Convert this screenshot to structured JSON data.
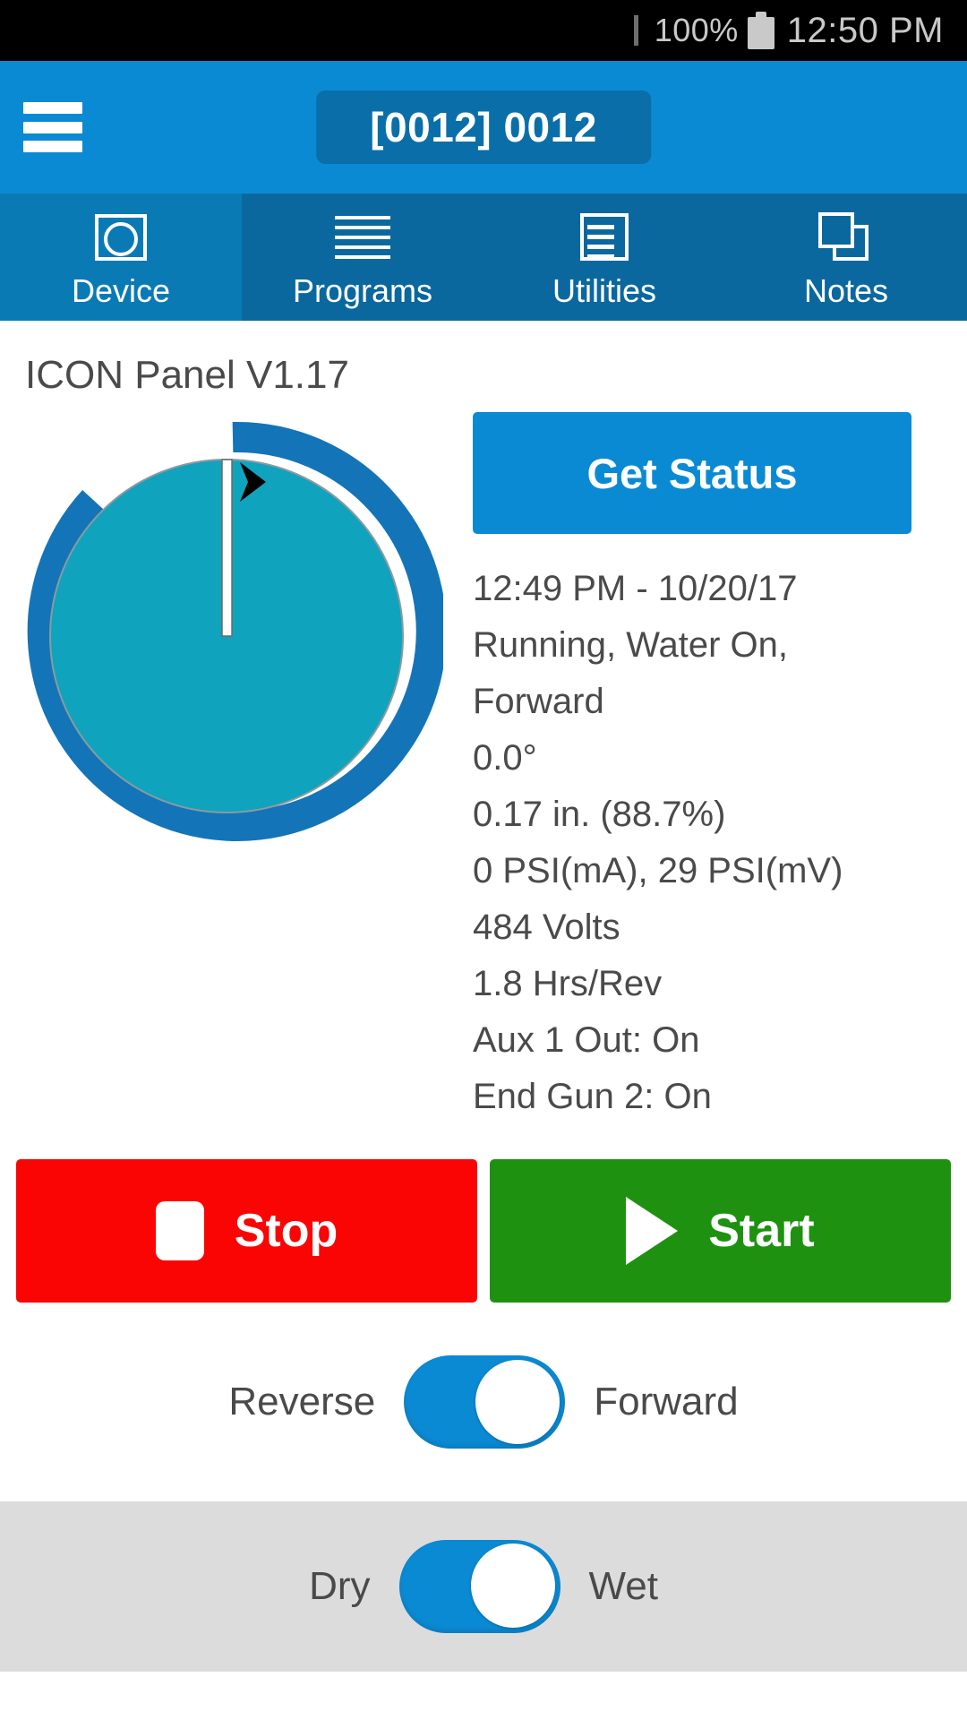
{
  "statusbar": {
    "battery_percent": "100%",
    "time": "12:50 PM",
    "battery_icon": "battery-full-icon"
  },
  "appbar": {
    "menu_icon": "hamburger-menu-icon",
    "title": "[0012] 0012"
  },
  "tabs": [
    {
      "label": "Device",
      "icon": "device-icon",
      "active": true
    },
    {
      "label": "Programs",
      "icon": "programs-icon",
      "active": false
    },
    {
      "label": "Utilities",
      "icon": "utilities-icon",
      "active": false
    },
    {
      "label": "Notes",
      "icon": "notes-icon",
      "active": false
    }
  ],
  "main": {
    "panel_title": "ICON Panel V1.17",
    "get_status_label": "Get Status",
    "status_lines": [
      "12:49 PM - 10/20/17",
      "Running, Water On,",
      "Forward",
      "0.0°",
      "0.17 in. (88.7%)",
      "0 PSI(mA), 29 PSI(mV)",
      "484 Volts",
      "1.8 Hrs/Rev",
      "Aux 1 Out: On",
      "End Gun 2: On"
    ],
    "dial": {
      "position_degrees": "0.0",
      "direction_marker": "forward-chevron-icon",
      "ring_color": "#1474b8",
      "field_color": "#0fa3bd",
      "pointer_color": "#ffffff"
    }
  },
  "controls": {
    "stop_label": "Stop",
    "stop_icon": "stop-square-icon",
    "stop_color": "#fb0404",
    "start_label": "Start",
    "start_icon": "play-triangle-icon",
    "start_color": "#1f9111"
  },
  "toggles": [
    {
      "left_label": "Reverse",
      "right_label": "Forward",
      "value": "Forward",
      "on": true,
      "color": "#0b8ad4"
    },
    {
      "left_label": "Dry",
      "right_label": "Wet",
      "value": "Wet",
      "on": true,
      "color": "#0b8ad4"
    }
  ]
}
